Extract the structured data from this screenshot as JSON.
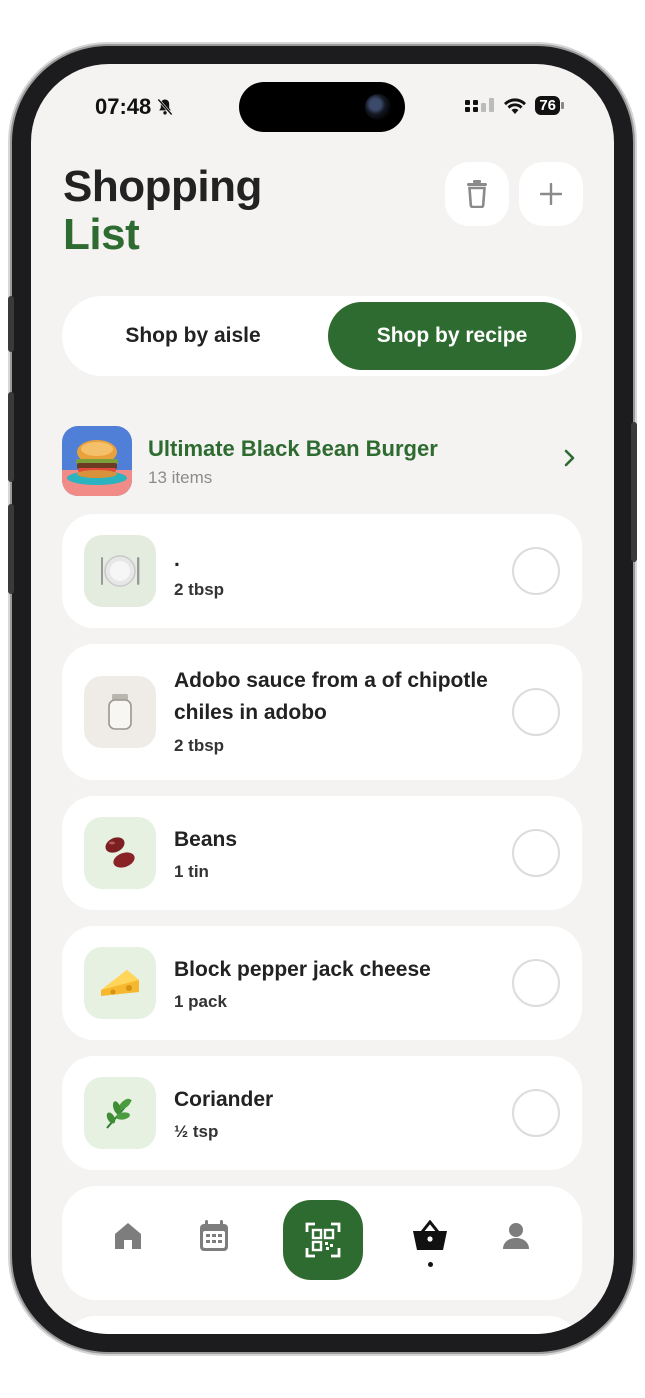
{
  "status_bar": {
    "time": "07:48",
    "battery": "76"
  },
  "header": {
    "title_line1": "Shopping",
    "title_line2": "List"
  },
  "segment": {
    "aisle_label": "Shop by aisle",
    "recipe_label": "Shop by recipe",
    "selected": "Shop by recipe"
  },
  "recipe": {
    "name": "Ultimate Black Bean Burger",
    "count": "13 items"
  },
  "ingredients": [
    {
      "name": ".",
      "quantity": "2 tbsp",
      "icon": "plate-cutlery-icon",
      "checked": false
    },
    {
      "name": "Adobo sauce from a of chipotle chiles in adobo",
      "quantity": "2 tbsp",
      "icon": "jar-icon",
      "checked": false
    },
    {
      "name": "Beans",
      "quantity": "1 tin",
      "icon": "beans-icon",
      "checked": false
    },
    {
      "name": "Block pepper jack cheese",
      "quantity": "1 pack",
      "icon": "cheese-icon",
      "checked": false
    },
    {
      "name": "Coriander",
      "quantity": "½ tsp",
      "icon": "herb-icon",
      "checked": false
    }
  ],
  "nav": {
    "items": [
      "home-icon",
      "calendar-icon",
      "scan-icon",
      "basket-icon",
      "profile-icon"
    ],
    "active": "basket-icon"
  },
  "colors": {
    "accent": "#2e6b30",
    "background": "#f4f3f1",
    "card": "#ffffff"
  }
}
